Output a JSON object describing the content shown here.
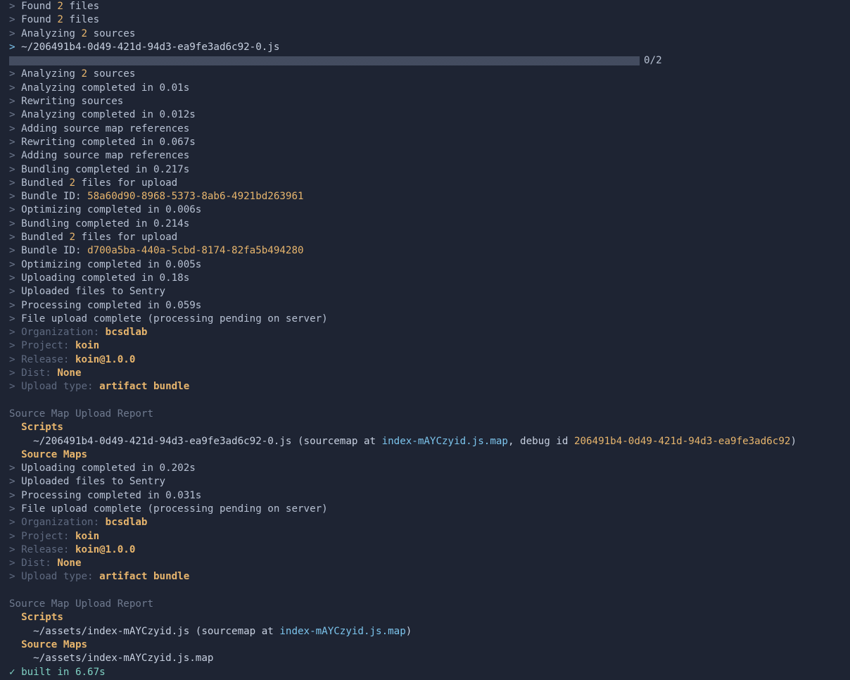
{
  "colors": {
    "background": "#1e2433",
    "text": "#b7c1d3",
    "prompt": "#6f7a8f",
    "number": "#e7b56d",
    "dim": "#5f6a80",
    "link": "#7cc4ec",
    "success": "#7fd1c3"
  },
  "icons": {
    "prompt": "chevron-right-icon",
    "success": "check-icon"
  },
  "progress": {
    "label": "0/2",
    "fraction": 0
  },
  "lines": [
    [
      {
        "c": "p",
        "t": "> "
      },
      {
        "c": "t",
        "t": "Found "
      },
      {
        "c": "n",
        "t": "2"
      },
      {
        "c": "t",
        "t": " files"
      }
    ],
    [
      {
        "c": "p",
        "t": "> "
      },
      {
        "c": "t",
        "t": "Found "
      },
      {
        "c": "n",
        "t": "2"
      },
      {
        "c": "t",
        "t": " files"
      }
    ],
    [
      {
        "c": "p",
        "t": "> "
      },
      {
        "c": "t",
        "t": "Analyzing "
      },
      {
        "c": "n",
        "t": "2"
      },
      {
        "c": "t",
        "t": " sources"
      }
    ],
    [
      {
        "c": "a",
        "t": "> "
      },
      {
        "c": "f",
        "t": "~/206491b4-0d49-421d-94d3-ea9fe3ad6c92-0.js"
      }
    ],
    {
      "progress": true
    },
    [
      {
        "c": "p",
        "t": "> "
      },
      {
        "c": "t",
        "t": "Analyzing "
      },
      {
        "c": "n",
        "t": "2"
      },
      {
        "c": "t",
        "t": " sources"
      }
    ],
    [
      {
        "c": "p",
        "t": "> "
      },
      {
        "c": "t",
        "t": "Analyzing completed in 0.01s"
      }
    ],
    [
      {
        "c": "p",
        "t": "> "
      },
      {
        "c": "t",
        "t": "Rewriting sources"
      }
    ],
    [
      {
        "c": "p",
        "t": "> "
      },
      {
        "c": "t",
        "t": "Analyzing completed in 0.012s"
      }
    ],
    [
      {
        "c": "p",
        "t": "> "
      },
      {
        "c": "t",
        "t": "Adding source map references"
      }
    ],
    [
      {
        "c": "p",
        "t": "> "
      },
      {
        "c": "t",
        "t": "Rewriting completed in 0.067s"
      }
    ],
    [
      {
        "c": "p",
        "t": "> "
      },
      {
        "c": "t",
        "t": "Adding source map references"
      }
    ],
    [
      {
        "c": "p",
        "t": "> "
      },
      {
        "c": "t",
        "t": "Bundling completed in 0.217s"
      }
    ],
    [
      {
        "c": "p",
        "t": "> "
      },
      {
        "c": "t",
        "t": "Bundled "
      },
      {
        "c": "n",
        "t": "2"
      },
      {
        "c": "t",
        "t": " files for upload"
      }
    ],
    [
      {
        "c": "p",
        "t": "> "
      },
      {
        "c": "t",
        "t": "Bundle ID: "
      },
      {
        "c": "g",
        "t": "58a60d90-8968-5373-8ab6-4921bd263961"
      }
    ],
    [
      {
        "c": "p",
        "t": "> "
      },
      {
        "c": "t",
        "t": "Optimizing completed in 0.006s"
      }
    ],
    [
      {
        "c": "p",
        "t": "> "
      },
      {
        "c": "t",
        "t": "Bundling completed in 0.214s"
      }
    ],
    [
      {
        "c": "p",
        "t": "> "
      },
      {
        "c": "t",
        "t": "Bundled "
      },
      {
        "c": "n",
        "t": "2"
      },
      {
        "c": "t",
        "t": " files for upload"
      }
    ],
    [
      {
        "c": "p",
        "t": "> "
      },
      {
        "c": "t",
        "t": "Bundle ID: "
      },
      {
        "c": "g",
        "t": "d700a5ba-440a-5cbd-8174-82fa5b494280"
      }
    ],
    [
      {
        "c": "p",
        "t": "> "
      },
      {
        "c": "t",
        "t": "Optimizing completed in 0.005s"
      }
    ],
    [
      {
        "c": "p",
        "t": "> "
      },
      {
        "c": "t",
        "t": "Uploading completed in 0.18s"
      }
    ],
    [
      {
        "c": "p",
        "t": "> "
      },
      {
        "c": "t",
        "t": "Uploaded files to Sentry"
      }
    ],
    [
      {
        "c": "p",
        "t": "> "
      },
      {
        "c": "t",
        "t": "Processing completed in 0.059s"
      }
    ],
    [
      {
        "c": "p",
        "t": "> "
      },
      {
        "c": "t",
        "t": "File upload complete (processing pending on server)"
      }
    ],
    [
      {
        "c": "d",
        "t": "> Organization: "
      },
      {
        "c": "v",
        "t": "bcsdlab"
      }
    ],
    [
      {
        "c": "d",
        "t": "> Project: "
      },
      {
        "c": "v",
        "t": "koin"
      }
    ],
    [
      {
        "c": "d",
        "t": "> Release: "
      },
      {
        "c": "v",
        "t": "koin@1.0.0"
      }
    ],
    [
      {
        "c": "d",
        "t": "> Dist: "
      },
      {
        "c": "v",
        "t": "None"
      }
    ],
    [
      {
        "c": "d",
        "t": "> Upload type: "
      },
      {
        "c": "v",
        "t": "artifact bundle"
      }
    ],
    [],
    [
      {
        "c": "h",
        "t": "Source Map Upload Report"
      }
    ],
    [
      {
        "c": "s",
        "t": "  Scripts"
      }
    ],
    [
      {
        "c": "f",
        "t": "    ~/206491b4-0d49-421d-94d3-ea9fe3ad6c92-0.js (sourcemap at "
      },
      {
        "c": "l",
        "t": "index-mAYCzyid.js.map"
      },
      {
        "c": "f",
        "t": ", debug id "
      },
      {
        "c": "g",
        "t": "206491b4-0d49-421d-94d3-ea9fe3ad6c92"
      },
      {
        "c": "f",
        "t": ")"
      }
    ],
    [
      {
        "c": "s",
        "t": "  Source Maps"
      }
    ],
    [
      {
        "c": "p",
        "t": "> "
      },
      {
        "c": "t",
        "t": "Uploading completed in 0.202s"
      }
    ],
    [
      {
        "c": "p",
        "t": "> "
      },
      {
        "c": "t",
        "t": "Uploaded files to Sentry"
      }
    ],
    [
      {
        "c": "p",
        "t": "> "
      },
      {
        "c": "t",
        "t": "Processing completed in 0.031s"
      }
    ],
    [
      {
        "c": "p",
        "t": "> "
      },
      {
        "c": "t",
        "t": "File upload complete (processing pending on server)"
      }
    ],
    [
      {
        "c": "d",
        "t": "> Organization: "
      },
      {
        "c": "v",
        "t": "bcsdlab"
      }
    ],
    [
      {
        "c": "d",
        "t": "> Project: "
      },
      {
        "c": "v",
        "t": "koin"
      }
    ],
    [
      {
        "c": "d",
        "t": "> Release: "
      },
      {
        "c": "v",
        "t": "koin@1.0.0"
      }
    ],
    [
      {
        "c": "d",
        "t": "> Dist: "
      },
      {
        "c": "v",
        "t": "None"
      }
    ],
    [
      {
        "c": "d",
        "t": "> Upload type: "
      },
      {
        "c": "v",
        "t": "artifact bundle"
      }
    ],
    [],
    [
      {
        "c": "h",
        "t": "Source Map Upload Report"
      }
    ],
    [
      {
        "c": "s",
        "t": "  Scripts"
      }
    ],
    [
      {
        "c": "f",
        "t": "    ~/assets/index-mAYCzyid.js (sourcemap at "
      },
      {
        "c": "l",
        "t": "index-mAYCzyid.js.map"
      },
      {
        "c": "f",
        "t": ")"
      }
    ],
    [
      {
        "c": "s",
        "t": "  Source Maps"
      }
    ],
    [
      {
        "c": "f",
        "t": "    ~/assets/index-mAYCzyid.js.map"
      }
    ],
    [
      {
        "c": "c",
        "t": "✓ built in 6.67s"
      }
    ]
  ]
}
